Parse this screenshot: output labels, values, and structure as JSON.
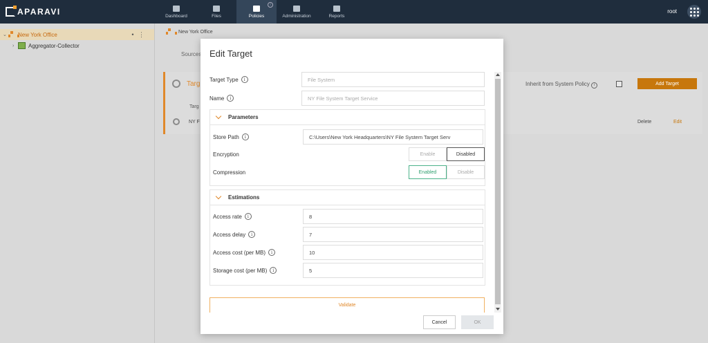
{
  "app": {
    "brand": "APARAVI",
    "user": "root"
  },
  "nav": [
    {
      "label": "Dashboard"
    },
    {
      "label": "Files"
    },
    {
      "label": "Policies",
      "badge": "i"
    },
    {
      "label": "Administration"
    },
    {
      "label": "Reports"
    }
  ],
  "sidebar": {
    "tree": [
      {
        "label": "New York Office",
        "selected": true
      },
      {
        "label": "Aggregator-Collector"
      }
    ]
  },
  "breadcrumb": {
    "text": "New York Office"
  },
  "background": {
    "tab": "Sources",
    "panel_title": "Targ",
    "inherit_label": "Inherit from System Policy",
    "add_target": "Add Target",
    "column_header": "Targ",
    "row_name": "NY F",
    "delete": "Delete",
    "edit": "Edit"
  },
  "modal": {
    "title": "Edit Target",
    "target_type": {
      "label": "Target Type",
      "placeholder": "File System"
    },
    "name": {
      "label": "Name",
      "placeholder": "NY File System Target Service"
    },
    "parameters": {
      "title": "Parameters",
      "store_path": {
        "label": "Store Path",
        "value": "C:\\Users\\New York Headquarters\\NY File System Target Serv"
      },
      "encryption": {
        "label": "Encryption",
        "enable": "Enable",
        "disable": "Disabled",
        "selected": "Disabled"
      },
      "compression": {
        "label": "Compression",
        "enable": "Enabled",
        "disable": "Disable",
        "selected": "Enabled"
      }
    },
    "estimations": {
      "title": "Estimations",
      "access_rate": {
        "label": "Access rate",
        "value": "8"
      },
      "access_delay": {
        "label": "Access delay",
        "value": "7"
      },
      "access_cost": {
        "label": "Access cost (per MB)",
        "value": "10"
      },
      "storage_cost": {
        "label": "Storage cost (per MB)",
        "value": "5"
      }
    },
    "validate": "Validate",
    "cancel": "Cancel",
    "ok": "OK"
  },
  "colors": {
    "accent": "#e0882a",
    "topbar": "#1f2d3d",
    "success": "#2e9e6e"
  }
}
